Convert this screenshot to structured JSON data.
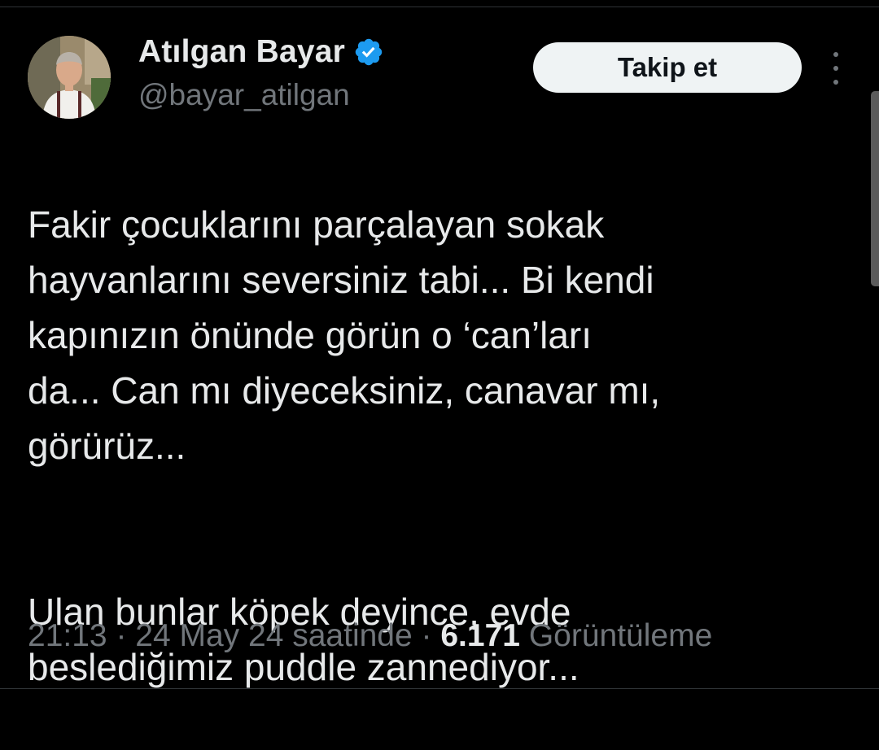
{
  "author": {
    "display_name": "Atılgan Bayar",
    "handle": "@bayar_atilgan",
    "verified": true,
    "verified_color": "#1d9bf0"
  },
  "actions": {
    "follow_label": "Takip et",
    "more_icon": "more-vertical-icon"
  },
  "tweet": {
    "paragraphs": [
      "Fakir çocuklarını parçalayan sokak\nhayvanlarını seversiniz tabi... Bi kendi\nkapınızın önünde görün o ‘can’ları\nda... Can mı diyeceksiniz, canavar mı,\ngörürüz...",
      "Ulan bunlar köpek deyince, evde\nbeslediğimiz puddle zannediyor..."
    ]
  },
  "meta": {
    "time": "21:13",
    "separator": " · ",
    "date": "24 May 24 saatinde",
    "views_count": "6.171",
    "views_label": "Görüntüleme"
  },
  "colors": {
    "background": "#000000",
    "text_primary": "#e7e9ea",
    "text_secondary": "#71767b",
    "follow_button_bg": "#eff3f4"
  }
}
